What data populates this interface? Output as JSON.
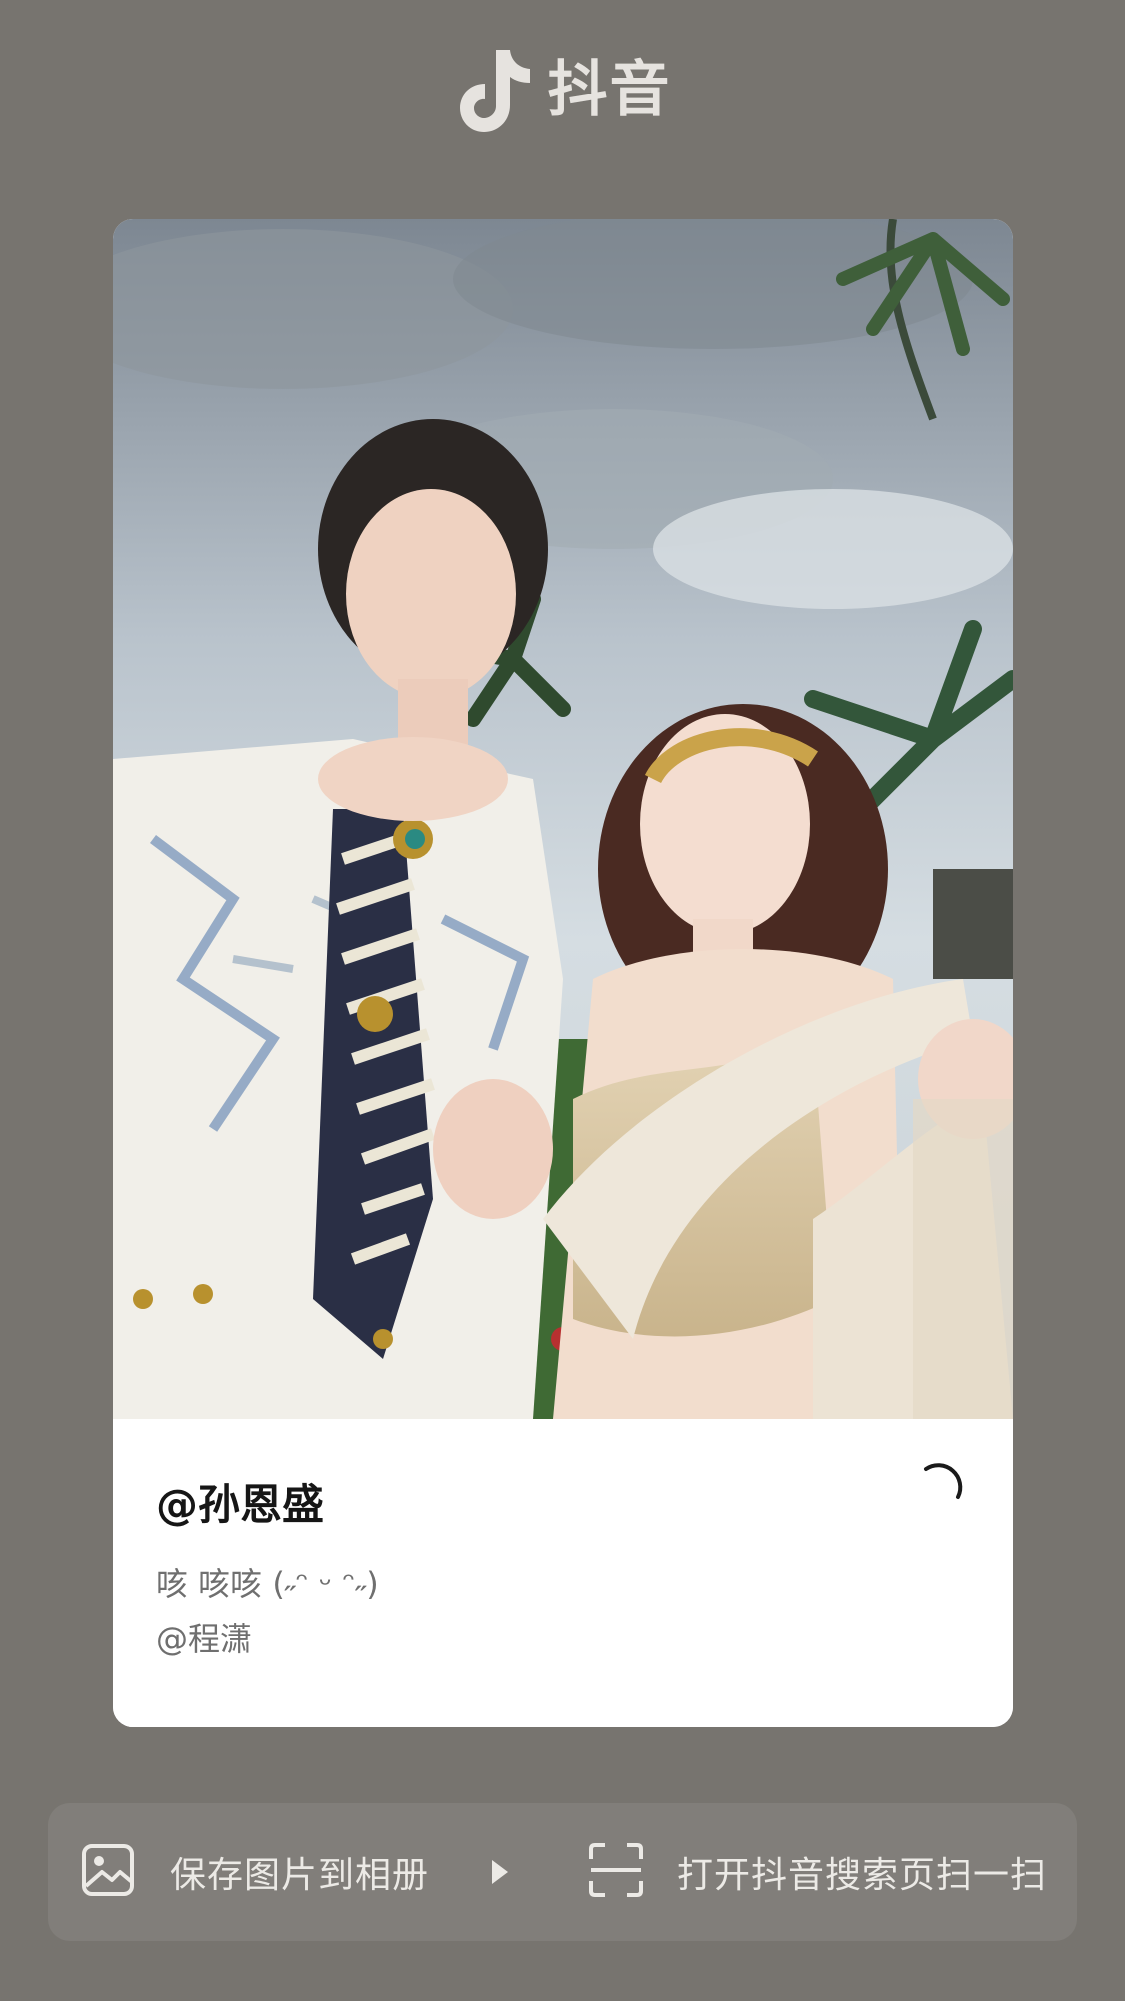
{
  "header": {
    "logo_icon": "douyin-note-icon",
    "logo_text": "抖音"
  },
  "card": {
    "image": "couple-photo",
    "username": "@孙恩盛",
    "caption": "咳 咳咳 (˶ᵔ ᵕ ᵔ˶)",
    "mention": "@程潇",
    "status_icon": "loading-spinner-icon"
  },
  "actions": {
    "save": {
      "icon": "image-icon",
      "label": "保存图片到相册"
    },
    "divider_icon": "play-triangle-icon",
    "scan": {
      "icon": "scan-frame-icon",
      "label": "打开抖音搜索页扫一扫"
    }
  },
  "colors": {
    "background": "#77746f",
    "card": "#ffffff",
    "username": "#161616",
    "caption": "#6f6f6f",
    "bar_text": "#eceae6"
  }
}
